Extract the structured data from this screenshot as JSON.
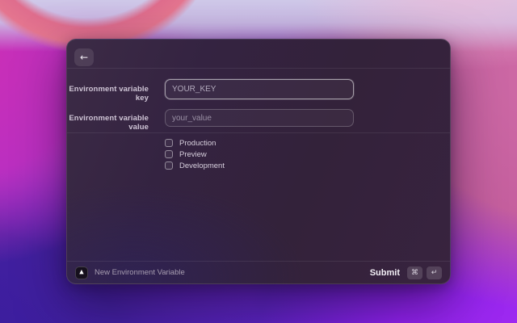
{
  "window": {
    "header": {
      "back_icon": "←"
    },
    "form": {
      "fields": [
        {
          "label": "Environment variable key",
          "placeholder": "YOUR_KEY",
          "value": "",
          "focused": true
        },
        {
          "label": "Environment variable value",
          "placeholder": "your_value",
          "value": "",
          "focused": false
        }
      ],
      "checkboxes": [
        {
          "label": "Production",
          "checked": false
        },
        {
          "label": "Preview",
          "checked": false
        },
        {
          "label": "Development",
          "checked": false
        }
      ]
    },
    "footer": {
      "app_icon": "vercel-triangle",
      "icon_glyph": "▲",
      "title": "New Environment Variable",
      "submit_label": "Submit",
      "shortcut_keys": [
        "⌘",
        "↵"
      ]
    }
  },
  "colors": {
    "window_background": "#342341",
    "window_border": "rgba(255,255,255,0.12)",
    "focused_input_border": "rgba(255,255,255,0.55)",
    "label_text": "#cfc5d6",
    "placeholder_text": "#9b91a6",
    "wallpaper_magenta": "#cd2fb5",
    "wallpaper_violet": "#8e21e9",
    "wallpaper_indigo": "#42209f",
    "wallpaper_rose": "#c55f9e",
    "wallpaper_lavender": "#cfc9e9"
  }
}
